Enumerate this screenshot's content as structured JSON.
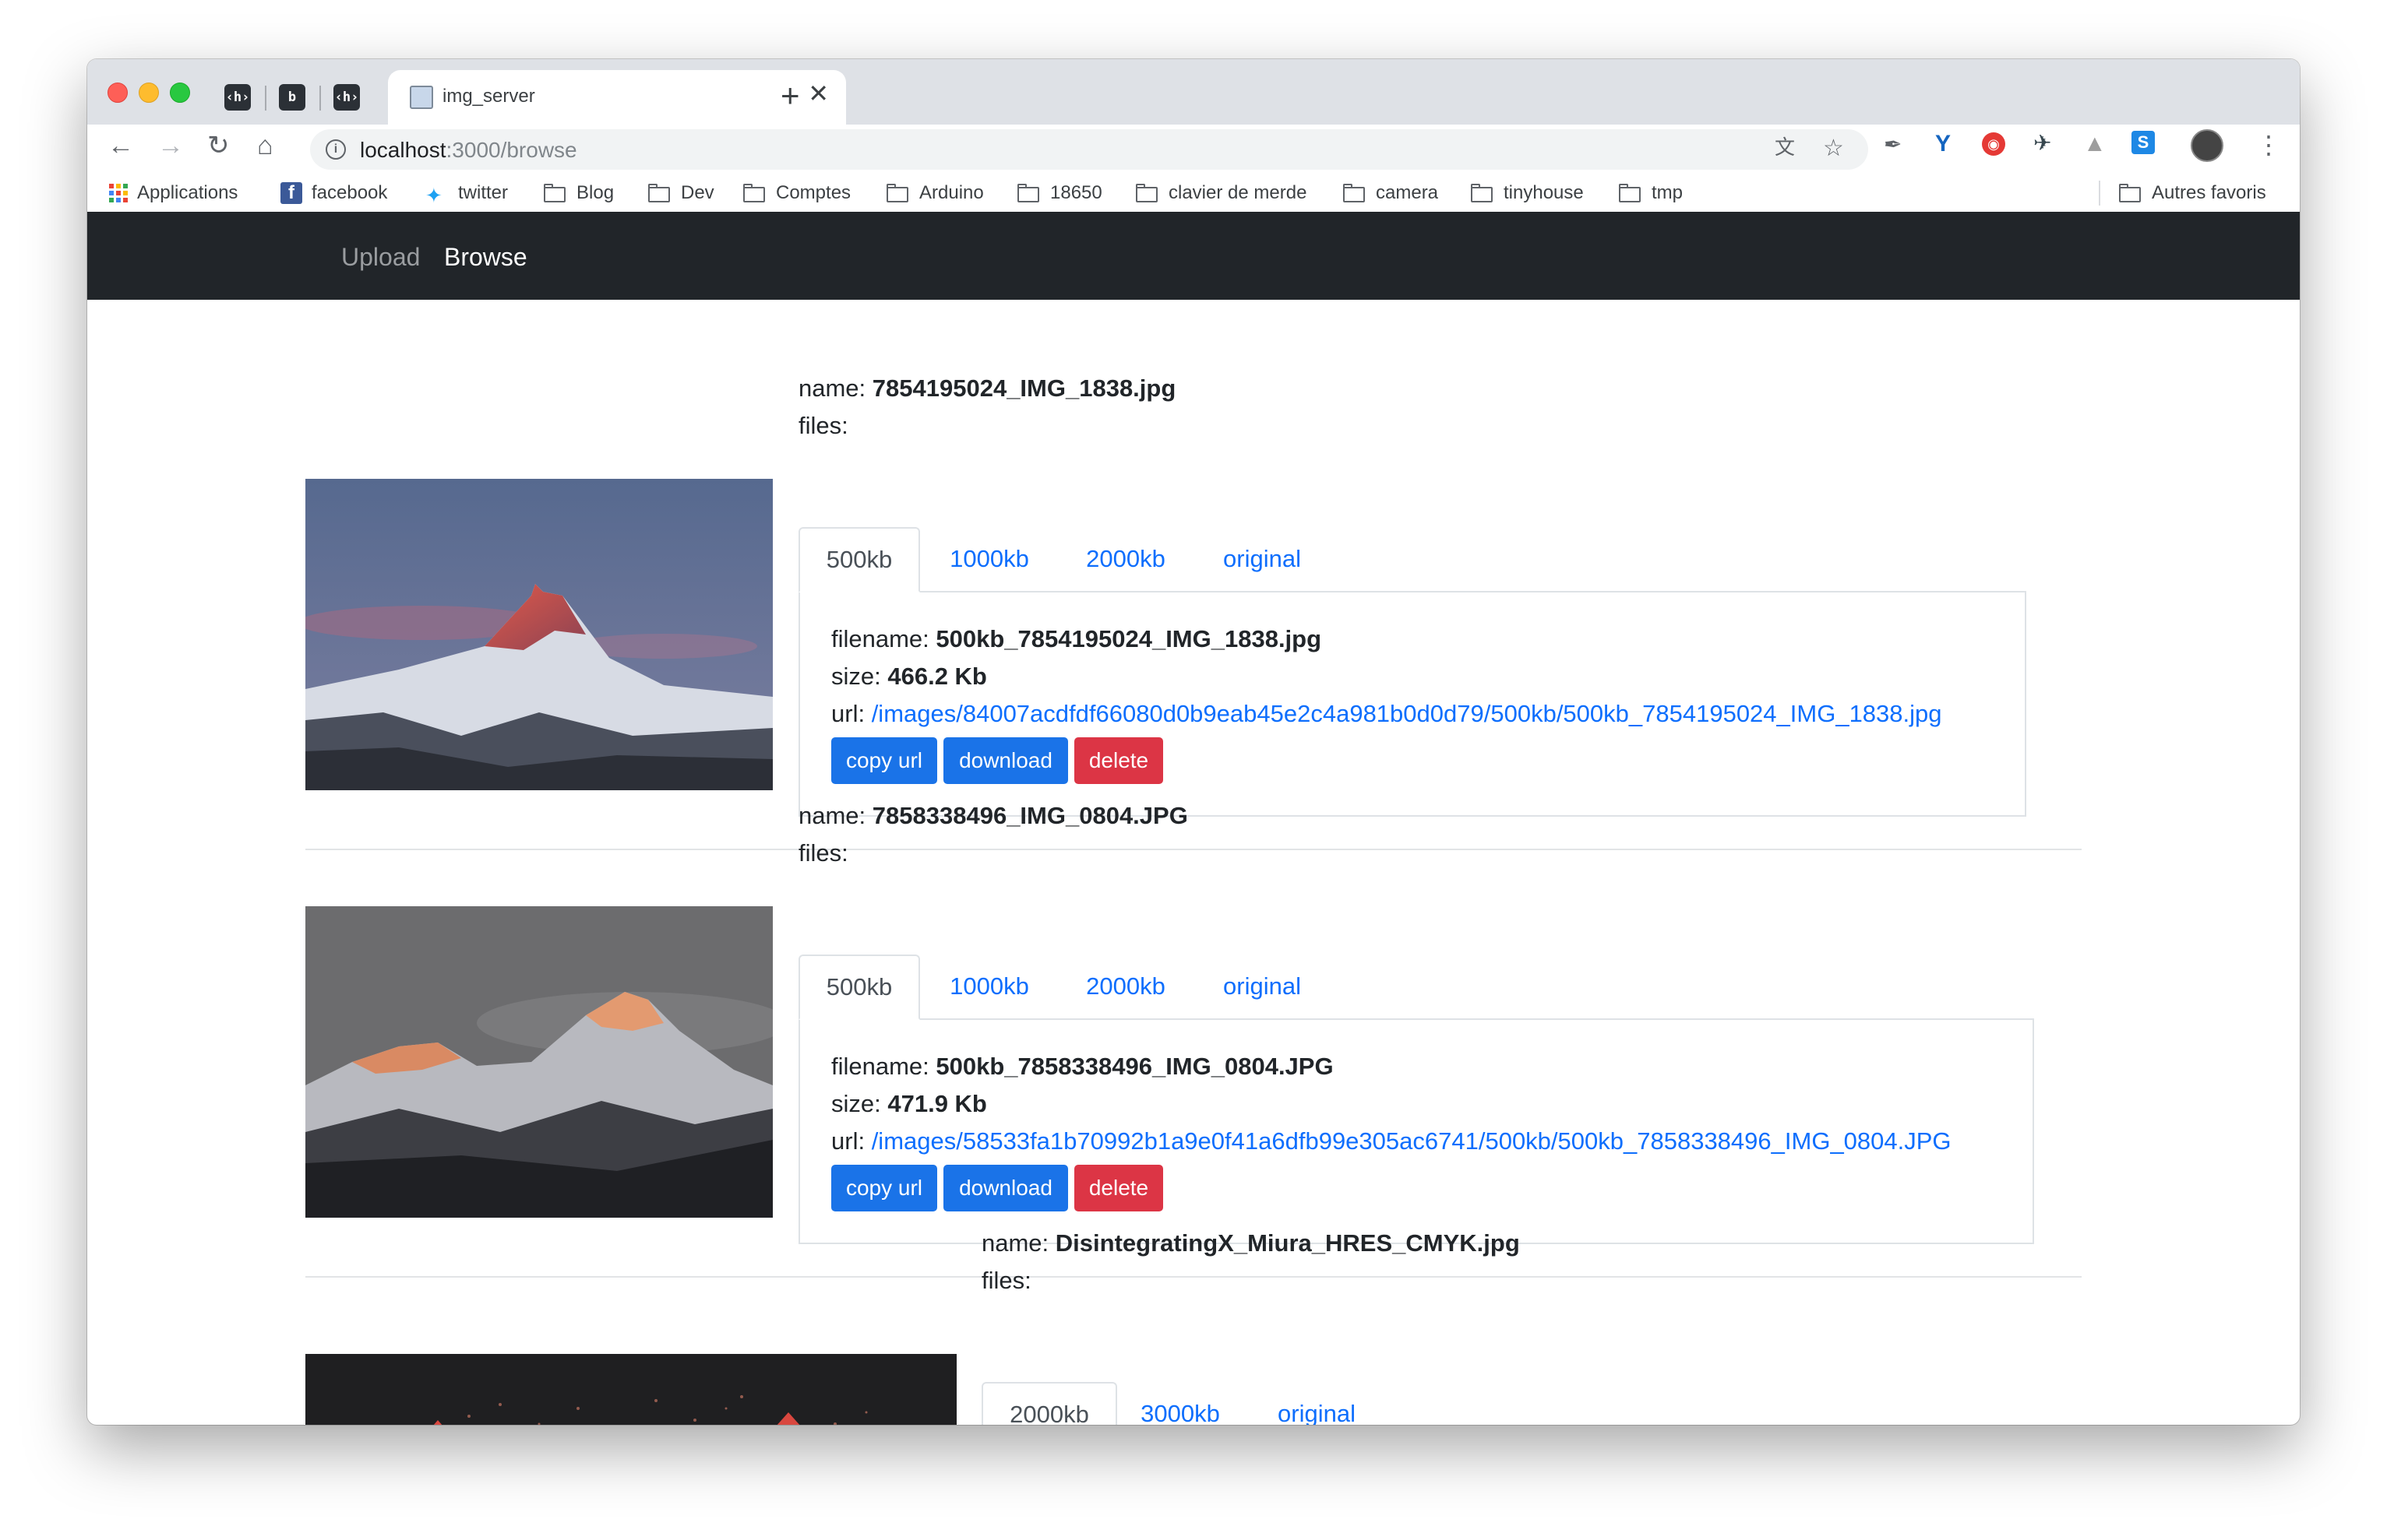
{
  "browser": {
    "pinned_tabs": [
      "‹h›",
      "b",
      "‹h›"
    ],
    "active_tab_title": "img_server",
    "new_tab_symbol": "+",
    "close_symbol": "✕",
    "url_host": "localhost",
    "url_path": ":3000/browse",
    "bookmarks": [
      {
        "label": "Applications",
        "icon": "apps-icon"
      },
      {
        "label": "facebook",
        "icon": "facebook-icon"
      },
      {
        "label": "twitter",
        "icon": "twitter-icon"
      },
      {
        "label": "Blog",
        "icon": "folder-icon"
      },
      {
        "label": "Dev",
        "icon": "folder-icon"
      },
      {
        "label": "Comptes",
        "icon": "folder-icon"
      },
      {
        "label": "Arduino",
        "icon": "folder-icon"
      },
      {
        "label": "18650",
        "icon": "folder-icon"
      },
      {
        "label": "clavier de merde",
        "icon": "folder-icon"
      },
      {
        "label": "camera",
        "icon": "folder-icon"
      },
      {
        "label": "tinyhouse",
        "icon": "folder-icon"
      },
      {
        "label": "tmp",
        "icon": "folder-icon"
      }
    ],
    "other_bookmarks": "Autres favoris"
  },
  "nav": {
    "upload": "Upload",
    "browse": "Browse"
  },
  "labels": {
    "name": "name: ",
    "files": "files:",
    "filename": "filename: ",
    "size": "size: ",
    "url": "url: ",
    "copy_url": "copy url",
    "download": "download",
    "delete": "delete"
  },
  "images": [
    {
      "name": "7854195024_IMG_1838.jpg",
      "tabs": [
        "500kb",
        "1000kb",
        "2000kb",
        "original"
      ],
      "active_tab": "500kb",
      "filename": "500kb_7854195024_IMG_1838.jpg",
      "size": "466.2 Kb",
      "url": "/images/84007acdfdf66080d0b9eab45e2c4a981b0d0d79/500kb/500kb_7854195024_IMG_1838.jpg"
    },
    {
      "name": "7858338496_IMG_0804.JPG",
      "tabs": [
        "500kb",
        "1000kb",
        "2000kb",
        "original"
      ],
      "active_tab": "500kb",
      "filename": "500kb_7858338496_IMG_0804.JPG",
      "size": "471.9 Kb",
      "url": "/images/58533fa1b70992b1a9e0f41a6dfb99e305ac6741/500kb/500kb_7858338496_IMG_0804.JPG"
    },
    {
      "name": "DisintegratingX_Miura_HRES_CMYK.jpg",
      "tabs": [
        "2000kb",
        "3000kb",
        "original"
      ],
      "active_tab": "2000kb"
    }
  ],
  "colors": {
    "navbar_bg": "#212529",
    "link": "#0d6efd",
    "button_primary": "#1a73e8",
    "button_danger": "#dc3545"
  }
}
